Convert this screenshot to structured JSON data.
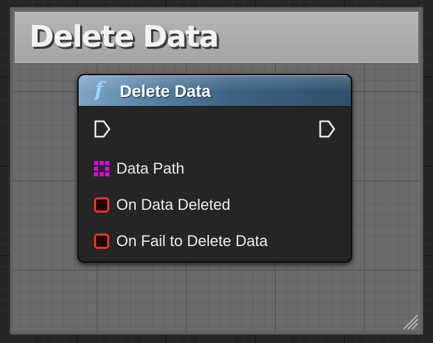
{
  "comment": {
    "title": "Delete Data"
  },
  "node": {
    "icon": "function-icon",
    "icon_glyph": "f",
    "title": "Delete Data",
    "header_color": "#4a7396",
    "pins": [
      {
        "label": "Data Path",
        "icon": "string-array-pin-icon",
        "color": "#e000e0"
      },
      {
        "label": "On Data Deleted",
        "icon": "delegate-pin-icon",
        "color": "#f13030"
      },
      {
        "label": "On Fail to Delete Data",
        "icon": "delegate-pin-icon",
        "color": "#f13030"
      }
    ],
    "exec_in_icon": "exec-in-pin-icon",
    "exec_out_icon": "exec-out-pin-icon"
  }
}
